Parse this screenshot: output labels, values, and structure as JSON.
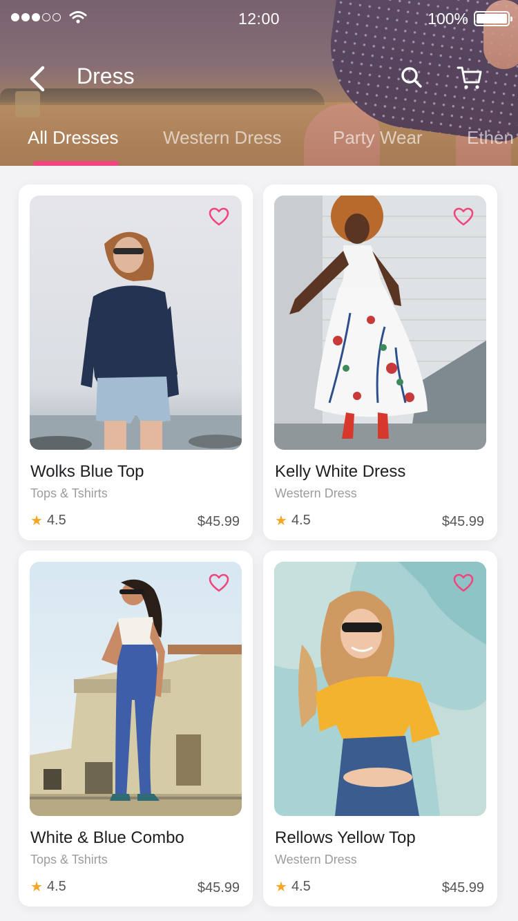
{
  "status_bar": {
    "time": "12:00",
    "battery_percent": "100%",
    "signal_bars_filled": 3,
    "signal_bars_total": 5
  },
  "header": {
    "title": "Dress",
    "back_icon": "chevron-left-icon",
    "search_icon": "search-icon",
    "cart_icon": "cart-icon"
  },
  "tabs": [
    {
      "label": "All Dresses",
      "active": true
    },
    {
      "label": "Western Dress",
      "active": false
    },
    {
      "label": "Party Wear",
      "active": false
    },
    {
      "label": "Ethen",
      "active": false
    }
  ],
  "colors": {
    "accent": "#f0457e",
    "star": "#f5a623",
    "text_primary": "#1e1e22",
    "text_secondary": "#9c9c9c"
  },
  "products": [
    {
      "name": "Wolks Blue Top",
      "category": "Tops & Tshirts",
      "rating": "4.5",
      "price": "$45.99",
      "favorite_icon": "heart-outline-icon"
    },
    {
      "name": "Kelly White Dress",
      "category": "Western Dress",
      "rating": "4.5",
      "price": "$45.99",
      "favorite_icon": "heart-outline-icon"
    },
    {
      "name": "White & Blue Combo",
      "category": "Tops & Tshirts",
      "rating": "4.5",
      "price": "$45.99",
      "favorite_icon": "heart-outline-icon"
    },
    {
      "name": "Rellows Yellow Top",
      "category": "Western Dress",
      "rating": "4.5",
      "price": "$45.99",
      "favorite_icon": "heart-outline-icon"
    }
  ]
}
